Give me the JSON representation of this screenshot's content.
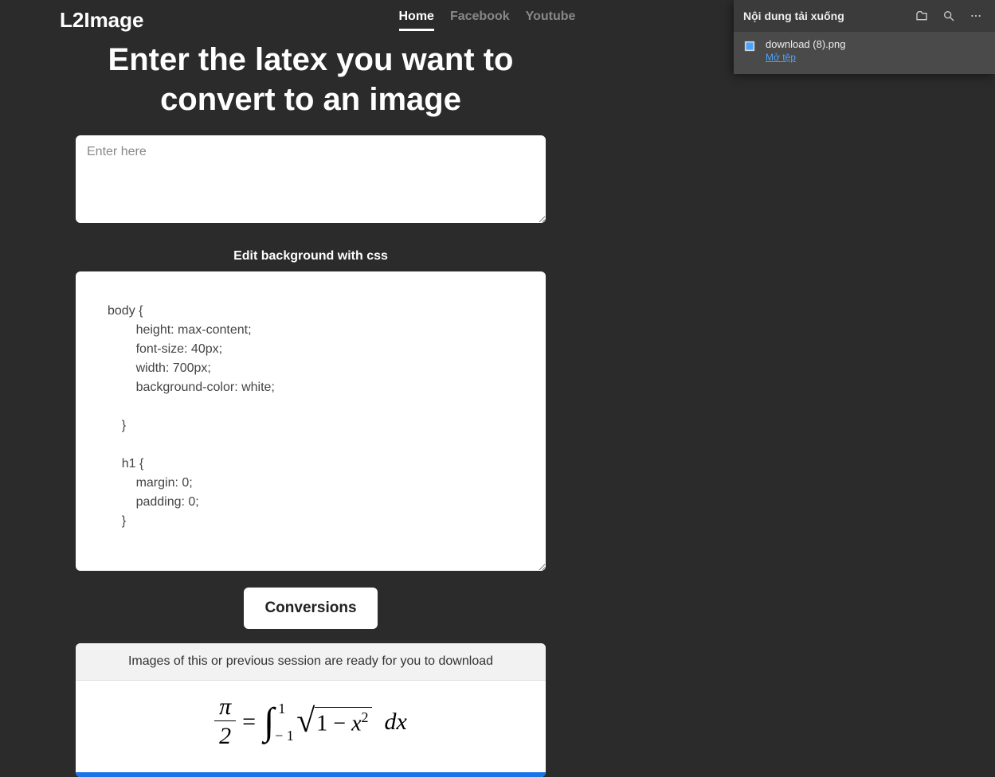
{
  "header": {
    "logo": "L2Image",
    "nav": {
      "home": "Home",
      "facebook": "Facebook",
      "youtube": "Youtube"
    }
  },
  "main": {
    "title": "Enter the latex you want to convert to an image",
    "latex_placeholder": "Enter here",
    "latex_value": "",
    "css_label": "Edit background with css",
    "css_value": "body {\n        height: max-content;\n        font-size: 40px;\n        width: 700px;\n        background-color: white;\n        \n    }\n\n    h1 {\n        margin: 0;\n        padding: 0;\n    }",
    "conversions_button": "Conversions",
    "results_header": "Images of this or previous session are ready for you to download",
    "formula": {
      "frac_num": "π",
      "frac_den": "2",
      "equals": "=",
      "int_upper": "1",
      "int_lower": "− 1",
      "sqrt_inner_prefix": "1 − ",
      "sqrt_var": "x",
      "sqrt_exp": "2",
      "dx": "dx"
    }
  },
  "downloads": {
    "title": "Nội dung tải xuống",
    "item": {
      "filename": "download (8).png",
      "action": "Mở tệp"
    }
  }
}
